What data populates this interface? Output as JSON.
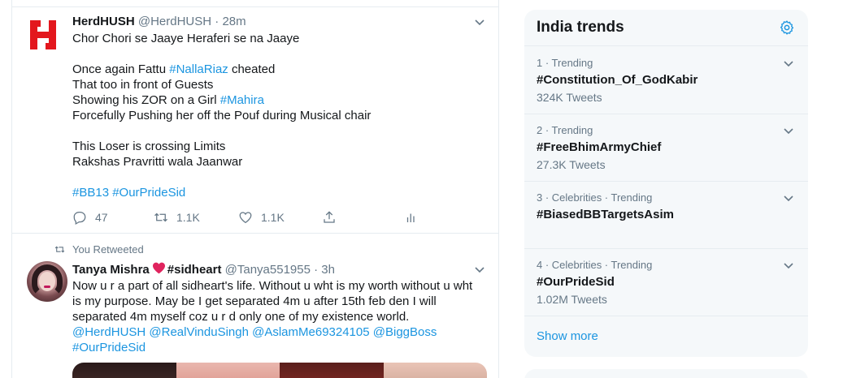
{
  "tweet1": {
    "name": "HerdHUSH",
    "handle": "@HerdHUSH",
    "sep": "·",
    "time": "28m",
    "lines": [
      {
        "text": "Chor Chori se Jaaye Heraferi se na Jaaye"
      },
      {
        "text": ""
      },
      {
        "pre": "Once again Fattu ",
        "link": "#NallaRiaz",
        "post": " cheated"
      },
      {
        "text": "That too in front of Guests"
      },
      {
        "pre": "Showing his ZOR on a Girl ",
        "link": "#Mahira",
        "post": ""
      },
      {
        "text": "Forcefully Pushing her off the Pouf during Musical chair"
      },
      {
        "text": ""
      },
      {
        "text": "This Loser is crossing Limits"
      },
      {
        "text": "Rakshas Pravritti wala Jaanwar"
      },
      {
        "text": ""
      }
    ],
    "hashtags": "#BB13 #OurPrideSid",
    "replies": "47",
    "retweets": "1.1K",
    "likes": "1.1K",
    "avatar_letter": "H",
    "avatar_color": "#e3171d"
  },
  "tweet2": {
    "retweet_note": "You Retweeted",
    "name_pre": "Tanya Mishra",
    "name_post": "#sidheart",
    "handle": "@Tanya551955",
    "sep": "·",
    "time": "3h",
    "body": "Now u r a part of all sidheart's life. Without u wht is my worth without u wht is my purpose. May be I get separated 4m u after 15th feb den I will separated 4m myself coz u r d only one of my existence world.",
    "mentions": "@HerdHUSH @RealVinduSingh @AslamMe69324105 @BiggBoss",
    "hashtag": "#OurPrideSid"
  },
  "trends": {
    "title": "India trends",
    "items": [
      {
        "meta": "1 · Trending",
        "name": "#Constitution_Of_GodKabir",
        "count": "324K Tweets"
      },
      {
        "meta": "2 · Trending",
        "name": "#FreeBhimArmyChief",
        "count": "27.3K Tweets"
      },
      {
        "meta": "3 · Celebrities · Trending",
        "name": "#BiasedBBTargetsAsim",
        "count": ""
      },
      {
        "meta": "4 · Celebrities · Trending",
        "name": "#OurPrideSid",
        "count": "1.02M Tweets"
      }
    ],
    "show_more": "Show more"
  },
  "colors": {
    "link": "#1b95e0",
    "muted": "#657786",
    "text": "#14171a",
    "heart": "#e0245e",
    "panel_bg": "#f5f8fa"
  },
  "icons": [
    "reply-icon",
    "retweet-icon",
    "like-icon",
    "share-icon",
    "analytics-icon",
    "chevron-down-icon",
    "gear-icon",
    "heart-emoji"
  ]
}
